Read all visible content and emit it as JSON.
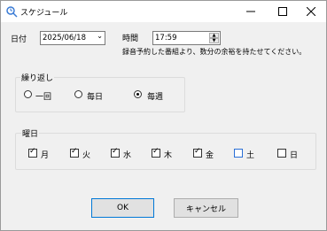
{
  "window": {
    "title": "スケジュール"
  },
  "date": {
    "label": "日付",
    "value": "2025/06/18"
  },
  "time": {
    "label": "時間",
    "value": "17:59"
  },
  "note": "録音予約した番組より、数分の余裕を持たせてください。",
  "repeat": {
    "title": "繰り返し",
    "options": [
      {
        "label": "一回",
        "selected": false
      },
      {
        "label": "毎日",
        "selected": false
      },
      {
        "label": "毎週",
        "selected": true
      }
    ]
  },
  "weekdays": {
    "title": "曜日",
    "days": [
      {
        "label": "月",
        "checked": true
      },
      {
        "label": "火",
        "checked": true
      },
      {
        "label": "水",
        "checked": true
      },
      {
        "label": "木",
        "checked": true
      },
      {
        "label": "金",
        "checked": true
      },
      {
        "label": "土",
        "checked": false,
        "focused": true
      },
      {
        "label": "日",
        "checked": false
      }
    ]
  },
  "buttons": {
    "ok": "OK",
    "cancel": "キャンセル"
  },
  "colors": {
    "focus": "#2a6fd6",
    "default_button_border": "#0078d7"
  }
}
